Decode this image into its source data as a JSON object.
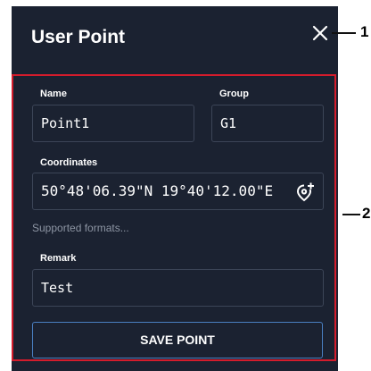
{
  "dialog": {
    "title": "User Point",
    "close_icon": "close-icon"
  },
  "form": {
    "name_label": "Name",
    "name_value": "Point1",
    "group_label": "Group",
    "group_value": "G1",
    "coordinates_label": "Coordinates",
    "coordinates_value": "50°48'06.39\"N 19°40'12.00\"E",
    "add_location_icon": "add-location-icon",
    "supported_formats": "Supported formats...",
    "remark_label": "Remark",
    "remark_value": "Test",
    "save_label": "SAVE POINT"
  },
  "callouts": {
    "c1": "1",
    "c2": "2"
  },
  "colors": {
    "panel_bg": "#1b2231",
    "accent_red": "#d41c2c",
    "button_border": "#4a7fc1",
    "field_border": "#3c4557"
  }
}
